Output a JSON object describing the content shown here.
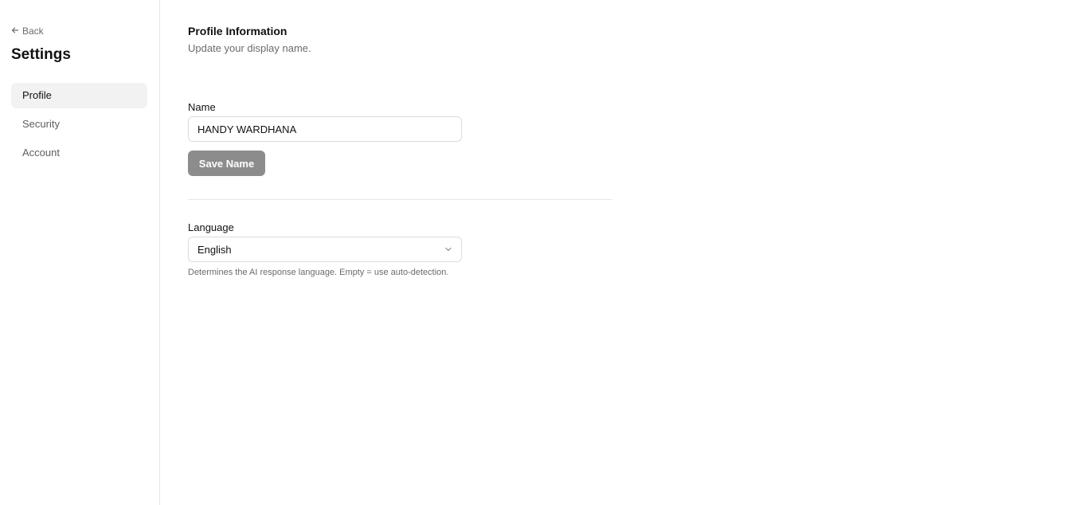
{
  "sidebar": {
    "back_label": "Back",
    "title": "Settings",
    "items": [
      {
        "label": "Profile",
        "active": true
      },
      {
        "label": "Security",
        "active": false
      },
      {
        "label": "Account",
        "active": false
      }
    ]
  },
  "profile": {
    "title": "Profile Information",
    "subtitle": "Update your display name.",
    "name_label": "Name",
    "name_value": "HANDY WARDHANA",
    "save_label": "Save Name"
  },
  "language": {
    "label": "Language",
    "selected": "English",
    "help": "Determines the AI response language. Empty = use auto-detection."
  },
  "icons": {
    "back": "arrow-left-icon",
    "select": "chevron-down-icon"
  },
  "colors": {
    "active_nav_bg": "#f2f2f2",
    "button_bg": "#8c8c8c",
    "muted_text": "#6b6b6b"
  }
}
